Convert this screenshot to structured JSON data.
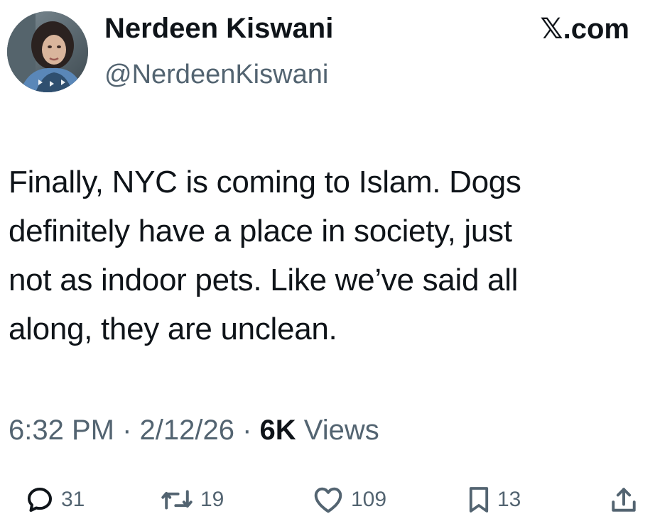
{
  "author": {
    "display_name": "Nerdeen Kiswani",
    "handle": "@NerdeenKiswani",
    "avatar_icon": "profile-photo"
  },
  "site": {
    "brand": "𝕏.com"
  },
  "tweet": {
    "lines": [
      "Finally, NYC is coming to Islam. Dogs",
      "definitely have a place in society, just",
      "not as indoor pets. Like we’ve said all",
      "along, they are unclean."
    ]
  },
  "meta": {
    "time": "6:32 PM",
    "sep1": " · ",
    "date": "2/12/26",
    "sep2": " · ",
    "views_count": "6K",
    "views_label": " Views"
  },
  "actions": {
    "replies": "31",
    "reposts": "19",
    "likes": "109",
    "bookmarks": "13",
    "icons": [
      "reply-icon",
      "repost-icon",
      "like-icon",
      "bookmark-icon",
      "share-icon"
    ]
  },
  "colors": {
    "text": "#0f1419",
    "secondary": "#536471",
    "background": "#ffffff"
  }
}
